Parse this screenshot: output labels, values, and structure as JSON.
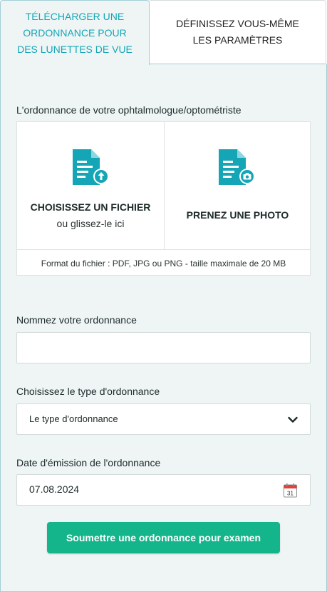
{
  "tabs": {
    "upload": "TÉLÉCHARGER UNE\nORDONNANCE POUR\nDES LUNETTES DE VUE",
    "manual": "DÉFINISSEZ VOUS-MÊME\nLES PARAMÈTRES"
  },
  "upload_section": {
    "label": "L'ordonnance de votre ophtalmologue/optométriste",
    "choose_file_title": "CHOISISSEZ UN FICHIER",
    "choose_file_sub": "ou glissez-le ici",
    "take_photo_title": "PRENEZ UNE PHOTO",
    "format_note": "Format du fichier : PDF, JPG ou PNG - taille maximale de 20 MB",
    "icons": [
      "document-upload-icon",
      "document-camera-icon"
    ]
  },
  "name_field": {
    "label": "Nommez votre ordonnance",
    "value": ""
  },
  "type_field": {
    "label": "Choisissez le type d'ordonnance",
    "selected": "Le type d'ordonnance"
  },
  "date_field": {
    "label": "Date d'émission de l'ordonnance",
    "value": "07.08.2024",
    "calendar_day": "31"
  },
  "submit": {
    "label": "Soumettre une ordonnance pour examen"
  },
  "colors": {
    "accent": "#14a6b7",
    "button": "#14b58a",
    "panel_bg": "#eff5f5",
    "calendar_red": "#e2413b"
  }
}
